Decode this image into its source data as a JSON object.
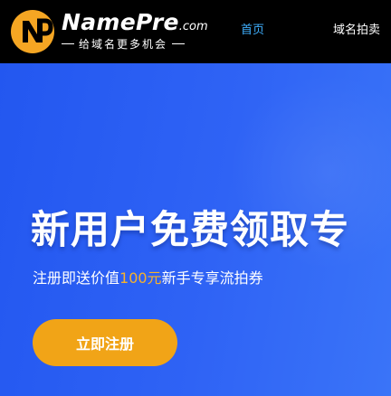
{
  "header": {
    "logo": {
      "name": "NamePre",
      "domain": ".com",
      "tagline": "给域名更多机会"
    },
    "nav": {
      "home_label": "首页",
      "auction_label": "域名拍卖"
    }
  },
  "hero": {
    "title": "新用户免费领取专",
    "subtitle_prefix": "注册即送价值",
    "subtitle_amount": "100元",
    "subtitle_suffix": "新手专享流拍券",
    "cta_label": "立即注册"
  },
  "colors": {
    "topbar_background": "#000000",
    "nav_active": "#3fb0ff",
    "hero_background": "#2357f0",
    "highlight": "#f6b22c",
    "cta_background": "#f1a417",
    "logo_mark": "#f5a623"
  },
  "icons": {
    "logo_mark": "np-logo-icon"
  }
}
